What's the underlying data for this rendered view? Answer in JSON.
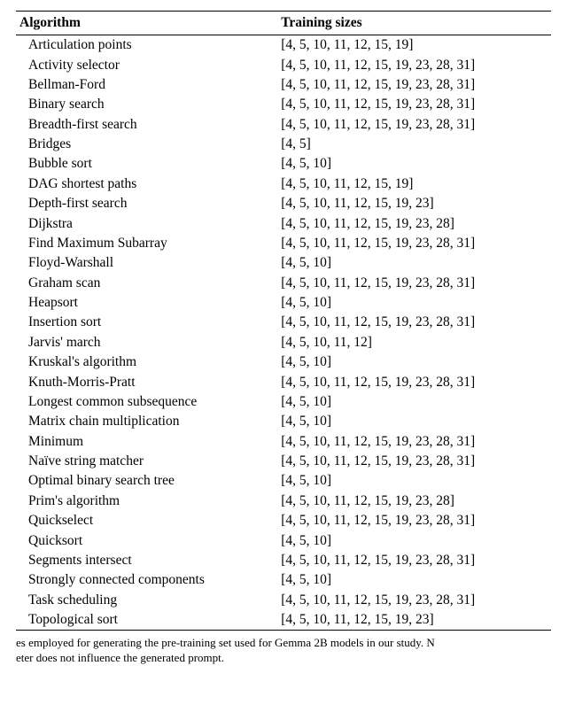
{
  "headers": {
    "algorithm": "Algorithm",
    "training_sizes": "Training sizes"
  },
  "rows": [
    {
      "algorithm": "Articulation points",
      "sizes": "[4, 5, 10, 11, 12, 15, 19]"
    },
    {
      "algorithm": "Activity selector",
      "sizes": "[4, 5, 10, 11, 12, 15, 19, 23, 28, 31]"
    },
    {
      "algorithm": "Bellman-Ford",
      "sizes": "[4, 5, 10, 11, 12, 15, 19, 23, 28, 31]"
    },
    {
      "algorithm": "Binary search",
      "sizes": "[4, 5, 10, 11, 12, 15, 19, 23, 28, 31]"
    },
    {
      "algorithm": "Breadth-first search",
      "sizes": "[4, 5, 10, 11, 12, 15, 19, 23, 28, 31]"
    },
    {
      "algorithm": "Bridges",
      "sizes": "[4, 5]"
    },
    {
      "algorithm": "Bubble sort",
      "sizes": "[4, 5, 10]"
    },
    {
      "algorithm": "DAG shortest paths",
      "sizes": "[4, 5, 10, 11, 12, 15, 19]"
    },
    {
      "algorithm": "Depth-first search",
      "sizes": "[4, 5, 10, 11, 12, 15, 19, 23]"
    },
    {
      "algorithm": "Dijkstra",
      "sizes": "[4, 5, 10, 11, 12, 15, 19, 23, 28]"
    },
    {
      "algorithm": "Find Maximum Subarray",
      "sizes": "[4, 5, 10, 11, 12, 15, 19, 23, 28, 31]"
    },
    {
      "algorithm": "Floyd-Warshall",
      "sizes": "[4, 5, 10]"
    },
    {
      "algorithm": "Graham scan",
      "sizes": "[4, 5, 10, 11, 12, 15, 19, 23, 28, 31]"
    },
    {
      "algorithm": "Heapsort",
      "sizes": "[4, 5, 10]"
    },
    {
      "algorithm": "Insertion sort",
      "sizes": "[4, 5, 10, 11, 12, 15, 19, 23, 28, 31]"
    },
    {
      "algorithm": "Jarvis' march",
      "sizes": "[4, 5, 10, 11, 12]"
    },
    {
      "algorithm": "Kruskal's algorithm",
      "sizes": "[4, 5, 10]"
    },
    {
      "algorithm": "Knuth-Morris-Pratt",
      "sizes": "[4, 5, 10, 11, 12, 15, 19, 23, 28, 31]"
    },
    {
      "algorithm": "Longest common subsequence",
      "sizes": "[4, 5, 10]"
    },
    {
      "algorithm": "Matrix chain multiplication",
      "sizes": "[4, 5, 10]"
    },
    {
      "algorithm": "Minimum",
      "sizes": "[4, 5, 10, 11, 12, 15, 19, 23, 28, 31]"
    },
    {
      "algorithm": "Naïve string matcher",
      "sizes": "[4, 5, 10, 11, 12, 15, 19, 23, 28, 31]"
    },
    {
      "algorithm": "Optimal binary search tree",
      "sizes": "[4, 5, 10]"
    },
    {
      "algorithm": "Prim's algorithm",
      "sizes": "[4, 5, 10, 11, 12, 15, 19, 23, 28]"
    },
    {
      "algorithm": "Quickselect",
      "sizes": "[4, 5, 10, 11, 12, 15, 19, 23, 28, 31]"
    },
    {
      "algorithm": "Quicksort",
      "sizes": "[4, 5, 10]"
    },
    {
      "algorithm": "Segments intersect",
      "sizes": "[4, 5, 10, 11, 12, 15, 19, 23, 28, 31]"
    },
    {
      "algorithm": "Strongly connected components",
      "sizes": "[4, 5, 10]"
    },
    {
      "algorithm": "Task scheduling",
      "sizes": "[4, 5, 10, 11, 12, 15, 19, 23, 28, 31]"
    },
    {
      "algorithm": "Topological sort",
      "sizes": "[4, 5, 10, 11, 12, 15, 19, 23]"
    }
  ],
  "caption": {
    "line1": "es employed for generating the pre-training set used for Gemma 2B models in our study. N",
    "line2": "eter does not influence the generated prompt."
  }
}
